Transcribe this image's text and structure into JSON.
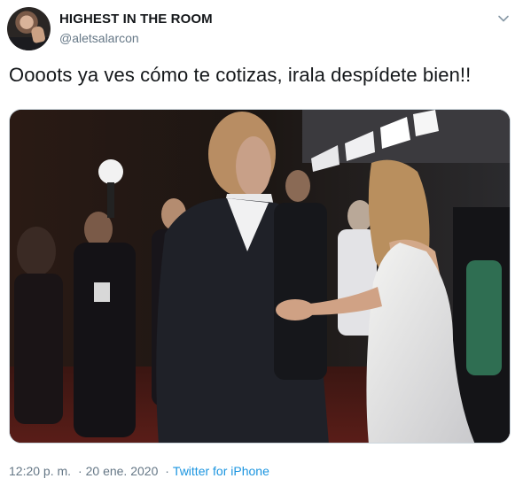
{
  "user": {
    "display_name": "HIGHEST IN THE ROOM",
    "handle": "@aletsalarcon"
  },
  "tweet": {
    "text": "Oooots ya ves cómo te cotizas, irala despídete bien!!"
  },
  "meta": {
    "time": "12:20 p. m.",
    "separator": "·",
    "date": "20 ene. 2020",
    "source": "Twitter for iPhone"
  },
  "icons": {
    "caret": "chevron-down-icon"
  },
  "colors": {
    "text": "#14171a",
    "secondary": "#657786",
    "link": "#1b95e0",
    "border": "#ccd6dd"
  }
}
